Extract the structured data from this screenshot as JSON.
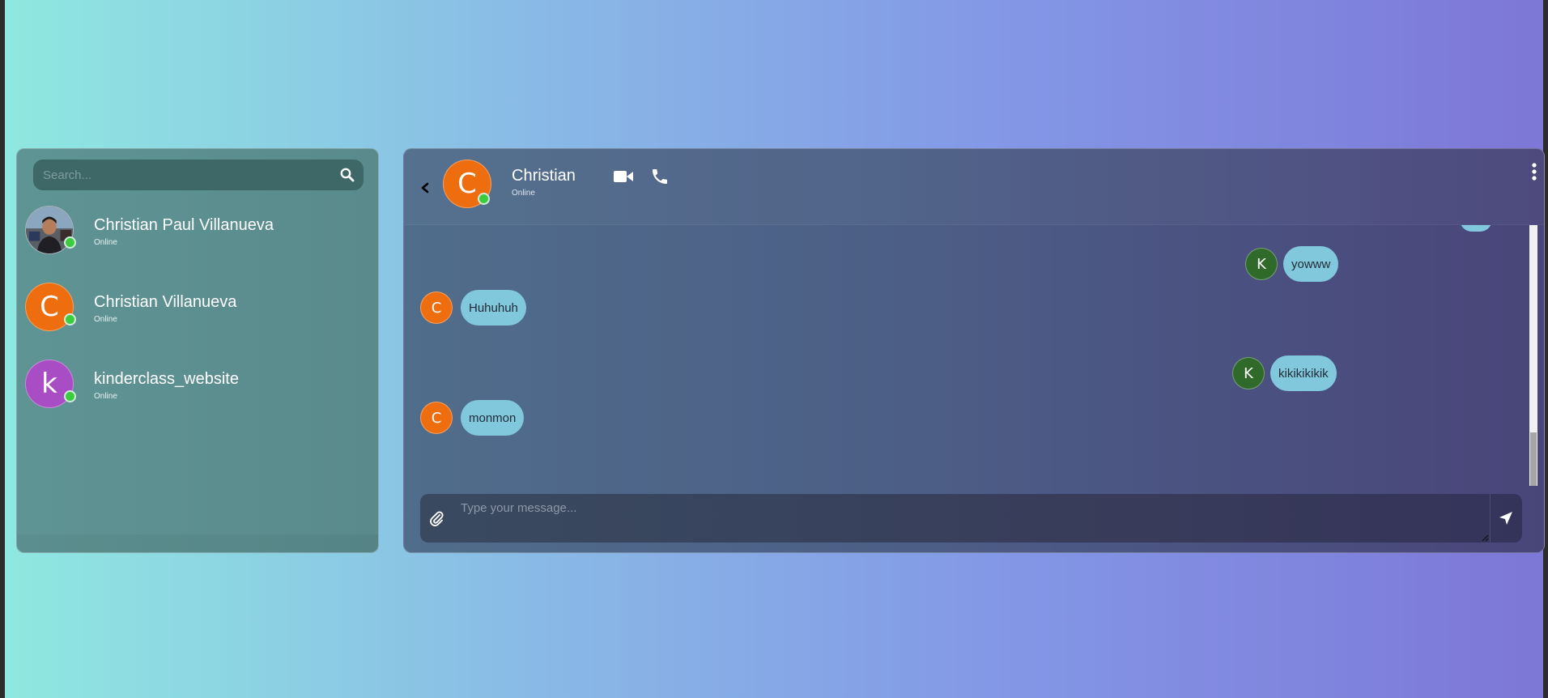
{
  "search": {
    "placeholder": "Search..."
  },
  "contacts": [
    {
      "name": "Christian Paul Villanueva",
      "status": "Online",
      "avatar_type": "photo",
      "online": true
    },
    {
      "name": "Christian Villanueva",
      "status": "Online",
      "initial": "C",
      "avatar_color": "#ee6d0e",
      "online": true
    },
    {
      "name": "kinderclass_website",
      "status": "Online",
      "initial": "k",
      "avatar_color": "#a94dc4",
      "online": true
    }
  ],
  "chat": {
    "contact_name": "Christian",
    "contact_status": "Online",
    "contact_initial": "C",
    "messages": [
      {
        "from": "me",
        "initial": "K",
        "text": "yowww"
      },
      {
        "from": "them",
        "initial": "C",
        "text": "Huhuhuh"
      },
      {
        "from": "me",
        "initial": "K",
        "text": "kikikikikik"
      },
      {
        "from": "them",
        "initial": "C",
        "text": "monmon"
      }
    ],
    "composer_placeholder": "Type your message..."
  },
  "icons": {
    "search": "search-icon",
    "back": "chevron-left-icon",
    "video": "video-camera-icon",
    "phone": "phone-icon",
    "more": "vertical-dots-icon",
    "attach": "paperclip-icon",
    "send": "paper-plane-icon"
  },
  "colors": {
    "online": "#3dcc3d",
    "bubble": "#82c8dd",
    "avatar_c": "#ee6d0e",
    "avatar_k": "#2f6a2a",
    "avatar_k_lower": "#a94dc4"
  }
}
